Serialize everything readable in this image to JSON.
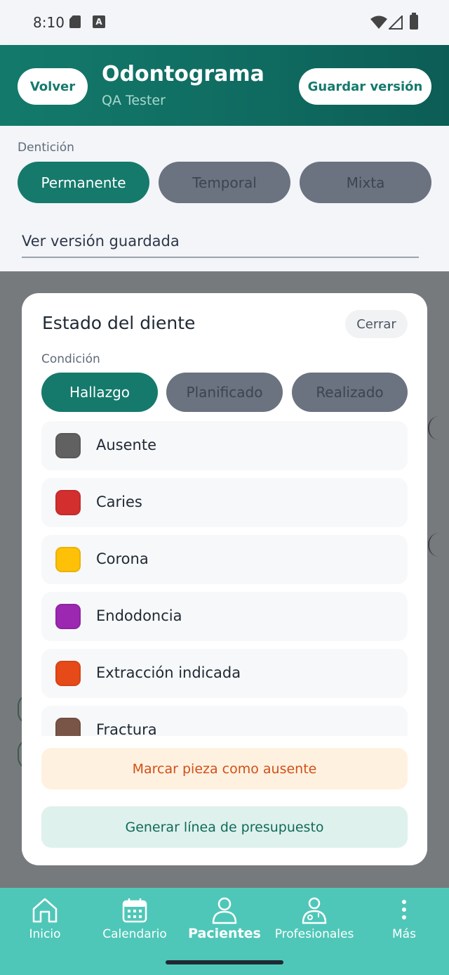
{
  "status_bar": {
    "time": "8:10",
    "icons": [
      "sd-card-icon",
      "font-icon",
      "wifi-icon",
      "signal-icon",
      "battery-icon"
    ]
  },
  "header": {
    "back_label": "Volver",
    "title": "Odontograma",
    "subtitle": "QA Tester",
    "save_label": "Guardar versión"
  },
  "dentition": {
    "label": "Dentición",
    "options": [
      "Permanente",
      "Temporal",
      "Mixta"
    ],
    "selected": "Permanente"
  },
  "version_select": {
    "value": "Ver versión guardada"
  },
  "modal": {
    "title": "Estado del diente",
    "close_label": "Cerrar",
    "condition_label": "Condición",
    "conditions": [
      "Hallazgo",
      "Planificado",
      "Realizado"
    ],
    "selected_condition": "Hallazgo",
    "states": [
      {
        "label": "Ausente",
        "color": "#616161"
      },
      {
        "label": "Caries",
        "color": "#d32f2f"
      },
      {
        "label": "Corona",
        "color": "#ffc107"
      },
      {
        "label": "Endodoncia",
        "color": "#9c27b0"
      },
      {
        "label": "Extracción indicada",
        "color": "#e64a19"
      },
      {
        "label": "Fractura",
        "color": "#795548"
      }
    ],
    "mark_absent_label": "Marcar pieza como ausente",
    "budget_label": "Generar línea de presupuesto"
  },
  "bottom_nav": {
    "items": [
      {
        "label": "Inicio",
        "icon": "home-icon"
      },
      {
        "label": "Calendario",
        "icon": "calendar-icon"
      },
      {
        "label": "Pacientes",
        "icon": "person-icon"
      },
      {
        "label": "Profesionales",
        "icon": "doctor-icon"
      },
      {
        "label": "Más",
        "icon": "more-vertical-icon"
      }
    ],
    "active": "Pacientes"
  },
  "colors": {
    "primary": "#157a6c",
    "nav_bg": "#4fc7b8",
    "warning_text": "#d14f17"
  }
}
